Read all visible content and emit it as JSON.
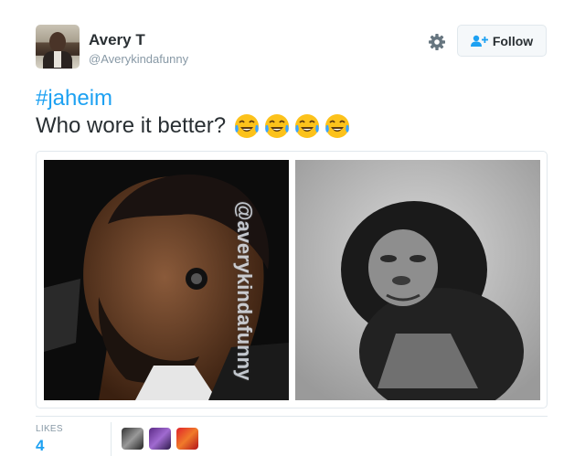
{
  "tweet": {
    "author_name": "Avery T",
    "author_handle": "@Averykindafunny",
    "hashtag": "#jaheim",
    "text": "Who wore it better?",
    "emojis": [
      "face-with-tears-of-joy",
      "face-with-tears-of-joy",
      "face-with-tears-of-joy",
      "face-with-tears-of-joy"
    ],
    "watermark": "@averykindafunny"
  },
  "actions": {
    "follow_label": "Follow",
    "gear_icon": "gear-icon",
    "follow_icon": "add-user-icon"
  },
  "stats": {
    "likes_label": "LIKES",
    "likes_count": "4"
  },
  "colors": {
    "link": "#1da1f2",
    "text": "#292f33",
    "muted": "#8899a6",
    "border": "#e1e8ed"
  }
}
